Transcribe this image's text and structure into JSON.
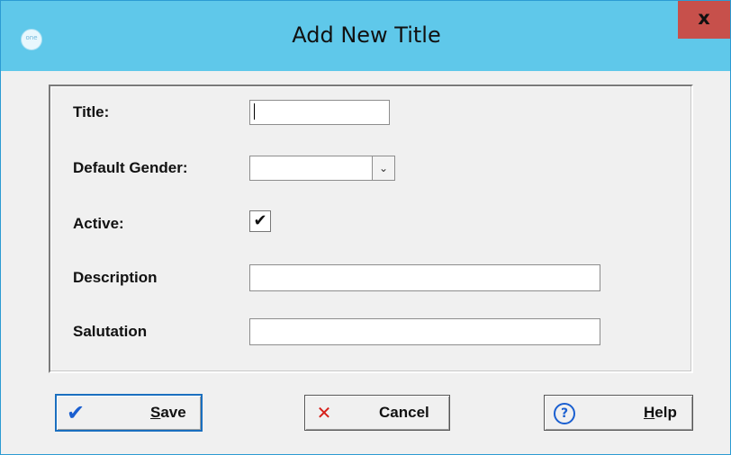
{
  "window": {
    "title": "Add New Title",
    "app_icon_text": "one",
    "close_label": "x"
  },
  "form": {
    "title_label": "Title:",
    "title_value": "",
    "gender_label": "Default Gender:",
    "gender_value": "",
    "gender_arrow_icon": "chevron-down-icon",
    "active_label": "Active:",
    "active_checked": true,
    "active_check_glyph": "✔",
    "description_label": "Description",
    "description_value": "",
    "salutation_label": "Salutation",
    "salutation_value": ""
  },
  "buttons": {
    "save": {
      "mnemonic": "S",
      "rest": "ave",
      "icon": "checkmark-icon",
      "icon_glyph": "✔",
      "icon_color": "#1a5fd0"
    },
    "cancel": {
      "label": "Cancel",
      "icon": "x-icon",
      "icon_glyph": "✕",
      "icon_color": "#d6201a"
    },
    "help": {
      "mnemonic": "H",
      "rest": "elp",
      "icon": "question-icon",
      "icon_glyph": "?",
      "icon_color": "#1a5fd0"
    }
  },
  "colors": {
    "titlebar": "#5fc8ea",
    "close_button": "#c7504b",
    "window_border": "#2c9bd3"
  }
}
